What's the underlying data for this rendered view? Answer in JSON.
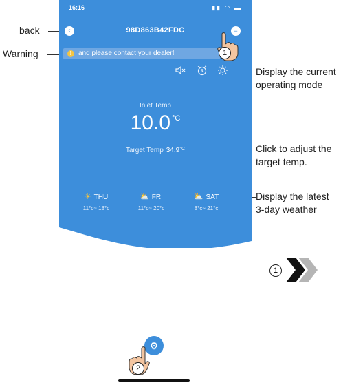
{
  "status_bar": {
    "time": "16:16",
    "icons": "signal-wifi-battery"
  },
  "header": {
    "title": "98D863B42FDC",
    "back_icon": "chevron-left-icon",
    "menu_icon": "menu-icon"
  },
  "warning": {
    "text": "and please contact your dealer!"
  },
  "modes": [
    "mute-icon",
    "alarm-clock-icon",
    "sun-icon"
  ],
  "temps": {
    "inlet_label": "Inlet Temp",
    "inlet_value": "10.0",
    "inlet_unit": "°C",
    "target_label": "Target Temp",
    "target_value": "34.9",
    "target_unit": "°C"
  },
  "weather": [
    {
      "day": "THU",
      "icon": "sun-icon",
      "range": "11°c~ 18°c"
    },
    {
      "day": "FRI",
      "icon": "partly-cloudy-icon",
      "range": "11°c~ 20°c"
    },
    {
      "day": "SAT",
      "icon": "partly-cloudy-icon",
      "range": "8°c~ 21°c"
    }
  ],
  "annotations": {
    "back": "back",
    "warning": "Warning",
    "mode_line1": "Display the current",
    "mode_line2": "operating mode",
    "target_line1": "Click to adjust the",
    "target_line2": "target temp.",
    "weather_line1": "Display the latest",
    "weather_line2": "3-day weather",
    "step1": "1",
    "step2": "2",
    "step_nav": "1"
  },
  "colors": {
    "accent": "#3d8edb",
    "warning_bar": "#6fa7e2",
    "warning_icon": "#f4c542",
    "chevron_dark": "#111111",
    "chevron_light": "#b5b5b5"
  }
}
